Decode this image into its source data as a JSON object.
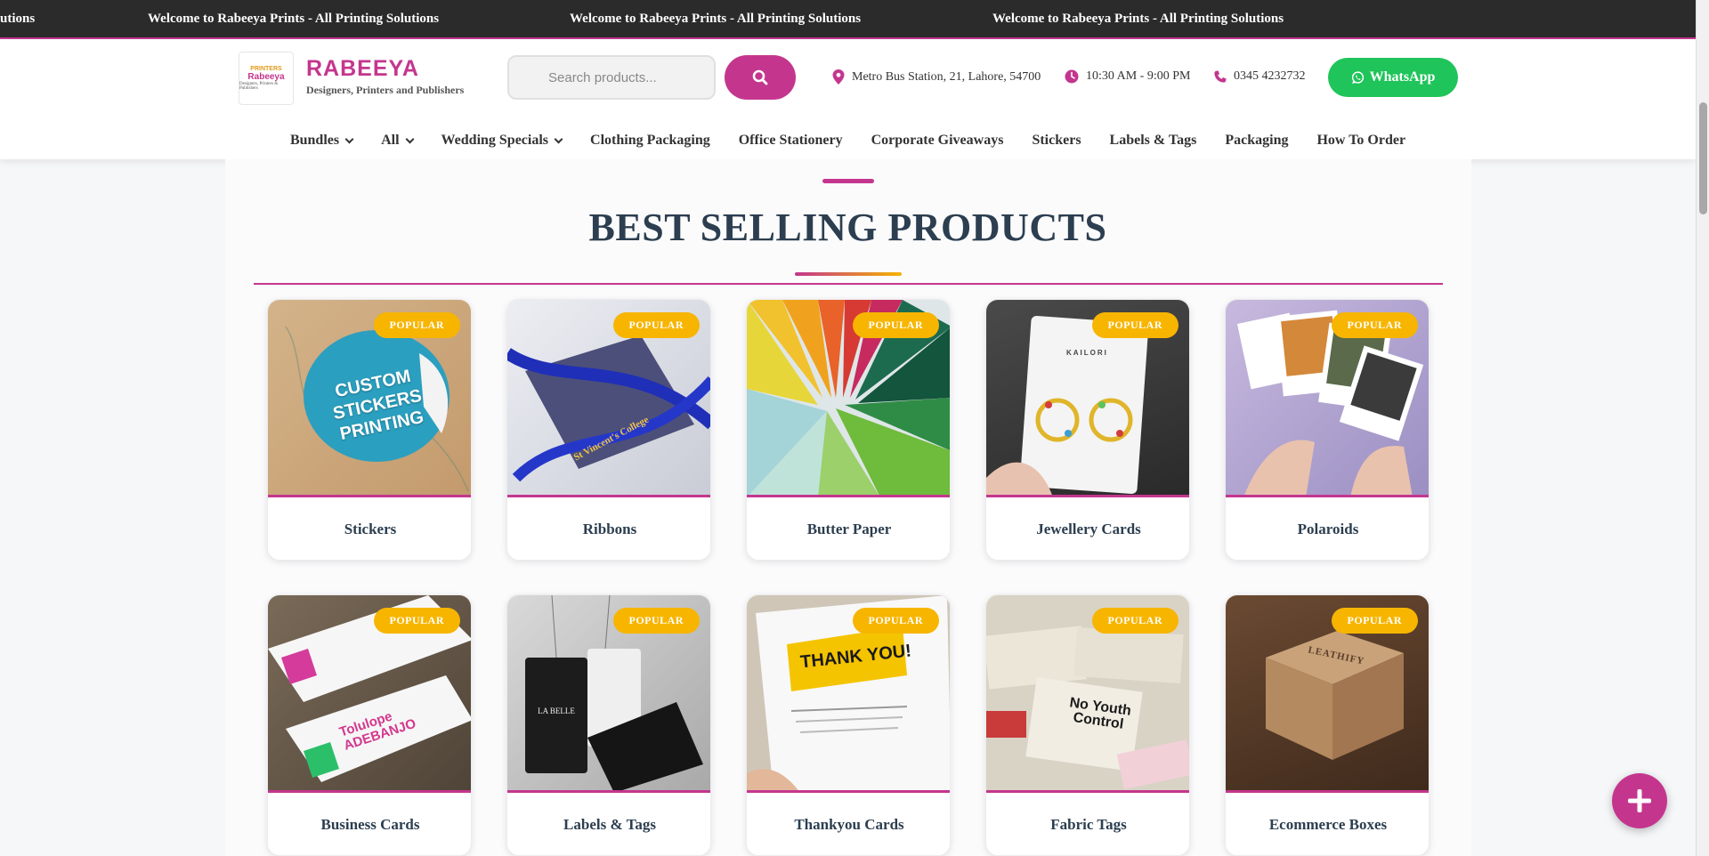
{
  "ticker": {
    "messages": [
      "utions",
      "Welcome to Rabeeya Prints - All Printing Solutions",
      "Welcome to Rabeeya Prints - All Printing Solutions",
      "Welcome to Rabeeya Prints - All Printing Solutions"
    ]
  },
  "header": {
    "logo": {
      "top": "PRINTERS",
      "mid": "Rabeeya",
      "bot": "Designers, Printers & Publishers"
    },
    "brand_name": "RABEEYA",
    "brand_tagline": "Designers, Printers and Publishers",
    "search_placeholder": "Search products...",
    "address": "Metro Bus Station, 21, Lahore, 54700",
    "hours": "10:30 AM - 9:00 PM",
    "phone": "0345 4232732",
    "whatsapp_label": "WhatsApp",
    "accent": "#c4368e",
    "whatsapp_color": "#1fc45a"
  },
  "nav": {
    "items": [
      {
        "label": "Bundles",
        "dropdown": true
      },
      {
        "label": "All",
        "dropdown": true
      },
      {
        "label": "Wedding Specials",
        "dropdown": true
      },
      {
        "label": "Clothing Packaging",
        "dropdown": false
      },
      {
        "label": "Office Stationery",
        "dropdown": false
      },
      {
        "label": "Corporate Giveaways",
        "dropdown": false
      },
      {
        "label": "Stickers",
        "dropdown": false
      },
      {
        "label": "Labels & Tags",
        "dropdown": false
      },
      {
        "label": "Packaging",
        "dropdown": false
      },
      {
        "label": "How To Order",
        "dropdown": false
      }
    ]
  },
  "section": {
    "title": "BEST SELLING PRODUCTS",
    "badge_label": "POPULAR",
    "badge_color": "#f7b500"
  },
  "products": [
    {
      "name": "Stickers",
      "image_text": "CUSTOM STICKERS PRINTING"
    },
    {
      "name": "Ribbons",
      "image_text": "St Vincent's College"
    },
    {
      "name": "Butter Paper",
      "image_text": ""
    },
    {
      "name": "Jewellery Cards",
      "image_text": "KAILORI"
    },
    {
      "name": "Polaroids",
      "image_text": ""
    },
    {
      "name": "Business Cards",
      "image_text": "Tolulope ADEBANJO"
    },
    {
      "name": "Labels & Tags",
      "image_text": "LA BELLE"
    },
    {
      "name": "Thankyou Cards",
      "image_text": "THANK YOU!"
    },
    {
      "name": "Fabric Tags",
      "image_text": "No Youth Control"
    },
    {
      "name": "Ecommerce Boxes",
      "image_text": "LEATHIFY"
    }
  ]
}
